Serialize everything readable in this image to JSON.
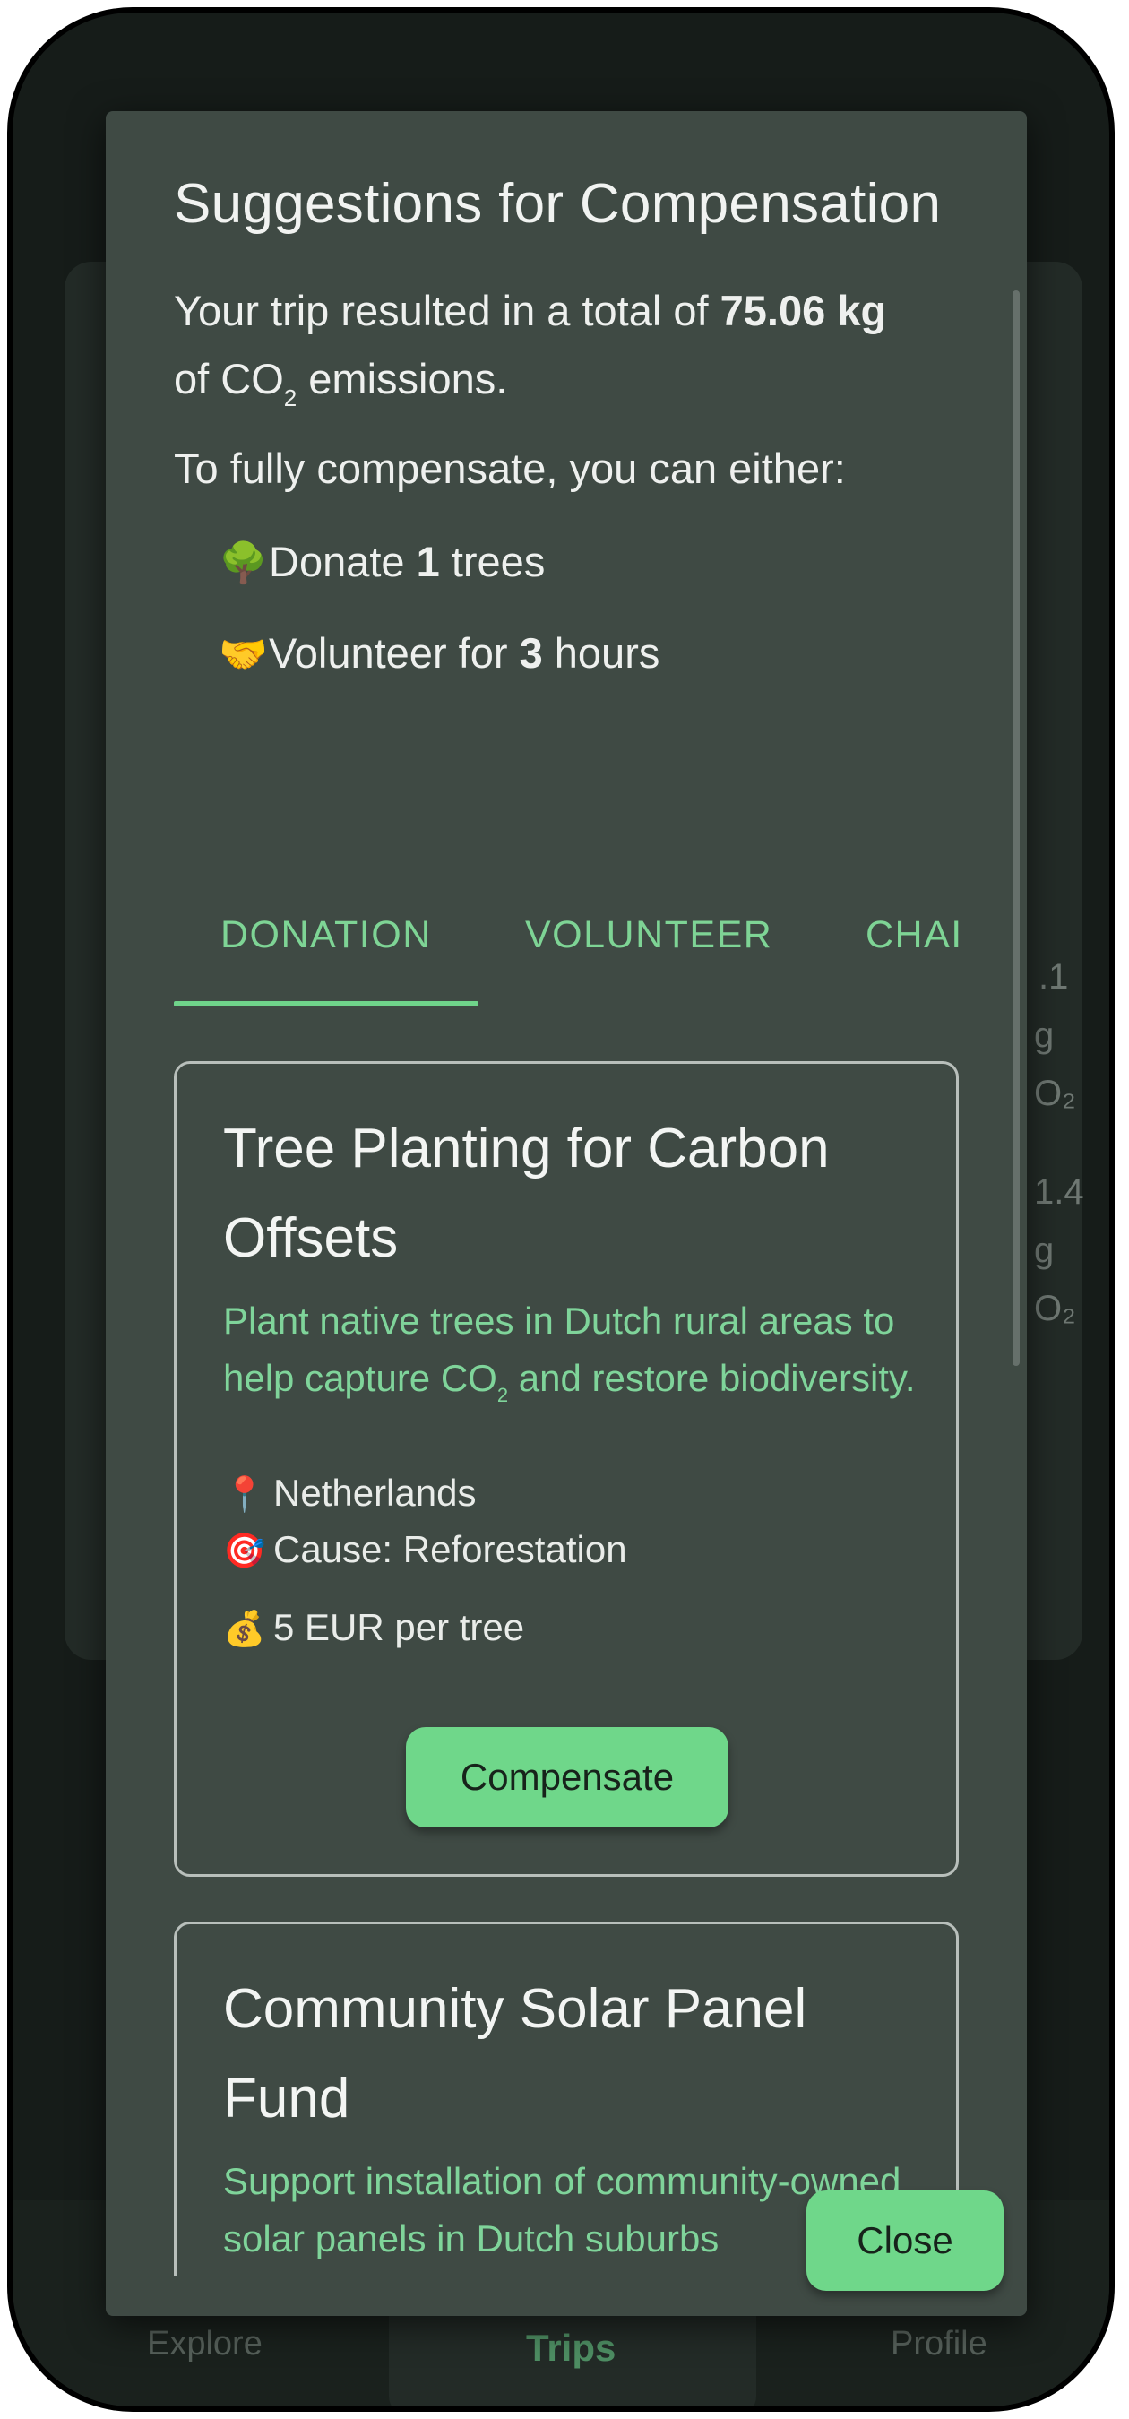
{
  "background": {
    "stats": [
      ".1",
      "g",
      "O₂",
      "1.4",
      "g",
      "O₂"
    ],
    "nav": {
      "explore": "Explore",
      "trips": "Trips",
      "profile": "Profile"
    }
  },
  "dialog": {
    "title": "Suggestions for Compensation",
    "summary_prefix": "Your trip resulted in a total of",
    "summary_amount": "75.06 kg",
    "summary_of": "of CO",
    "summary_sub": "2",
    "summary_suffix": "emissions.",
    "either_text": "To fully compensate, you can either:",
    "options": [
      {
        "icon": "tree-icon",
        "prefix": "Donate",
        "value": "1",
        "suffix": "trees"
      },
      {
        "icon": "handshake-icon",
        "prefix": "Volunteer for",
        "value": "3",
        "suffix": "hours"
      }
    ],
    "tabs": [
      "DONATION",
      "VOLUNTEER",
      "CHAI"
    ],
    "active_tab": "DONATION",
    "cards": [
      {
        "title": "Tree Planting for Carbon Offsets",
        "desc_a": "Plant native trees in Dutch rural areas to help capture CO",
        "desc_sub": "2",
        "desc_b": "and restore biodiversity.",
        "location": "Netherlands",
        "cause": "Cause: Reforestation",
        "price": "5 EUR per tree",
        "button": "Compensate"
      },
      {
        "title": "Community Solar Panel Fund",
        "desc": "Support installation of community-owned solar panels in Dutch suburbs"
      }
    ],
    "close_label": "Close"
  },
  "colors": {
    "accent": "#6fd78a",
    "dialog_bg": "#3f4a44",
    "app_bg": "#161c19"
  }
}
